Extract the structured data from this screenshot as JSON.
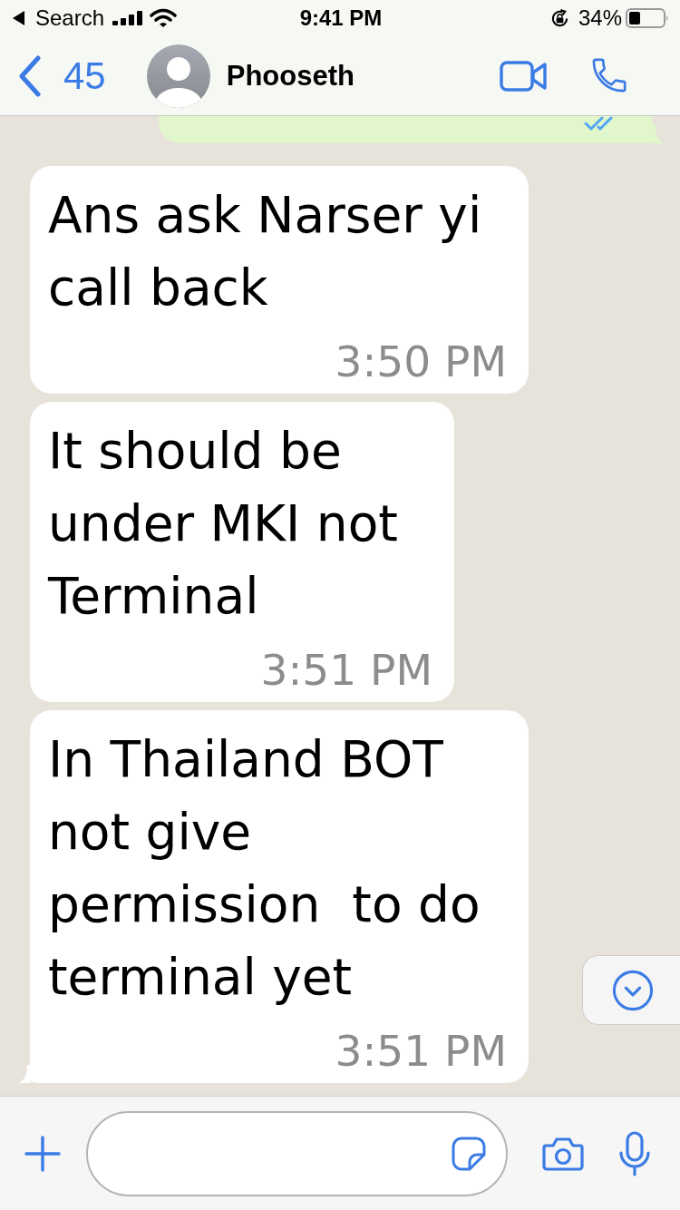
{
  "status_bar": {
    "back_label": "Search",
    "time": "9:41 PM",
    "battery_percent": "34%"
  },
  "header": {
    "back_count": "45",
    "contact_name": "Phooseth"
  },
  "chat": {
    "partial_message": {
      "outgoing": true,
      "read": true,
      "tail": true
    },
    "messages": [
      {
        "outgoing": false,
        "text": "Ans ask Narser yi call back",
        "time": "3:50 PM",
        "tail": false
      },
      {
        "outgoing": false,
        "text": "It should be under MKI not Terminal",
        "time": "3:51 PM",
        "tail": false
      },
      {
        "outgoing": false,
        "text": "In Thailand BOT not give permission  to do terminal yet",
        "time": "3:51 PM",
        "tail": true
      }
    ]
  }
}
